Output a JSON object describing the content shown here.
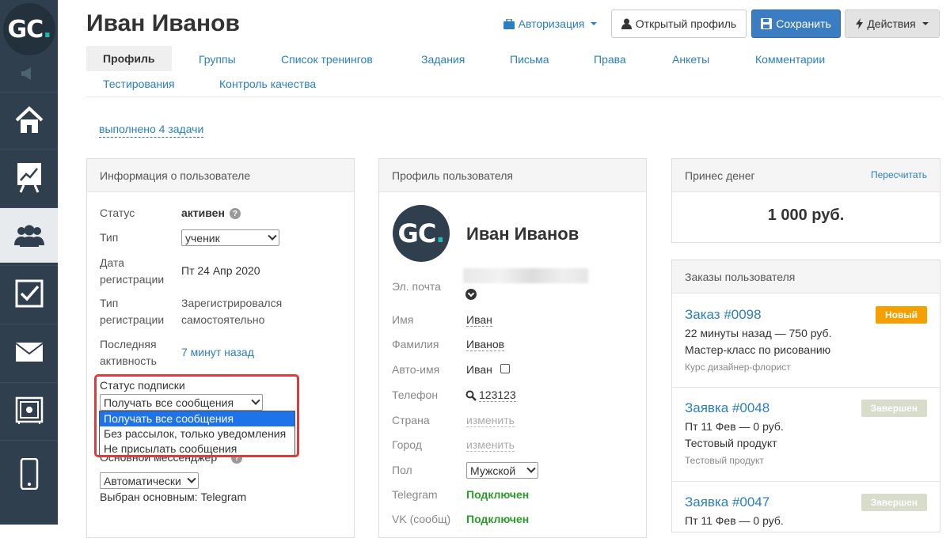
{
  "logo": {
    "text": "GC",
    "dot": "."
  },
  "sidebar": {
    "items": [
      {
        "icon": "home-icon"
      },
      {
        "icon": "chart-board-icon"
      },
      {
        "icon": "users-icon",
        "active": true
      },
      {
        "icon": "checkbox-icon"
      },
      {
        "icon": "mail-icon"
      },
      {
        "icon": "safe-icon"
      },
      {
        "icon": "mobile-icon"
      }
    ]
  },
  "header": {
    "title": "Иван Иванов",
    "auth_label": "Авторизация",
    "open_profile_label": "Открытый профиль",
    "save_label": "Сохранить",
    "actions_label": "Действия"
  },
  "tabs": [
    {
      "label": "Профиль",
      "active": true
    },
    {
      "label": "Группы"
    },
    {
      "label": "Список тренингов"
    },
    {
      "label": "Задания"
    },
    {
      "label": "Письма"
    },
    {
      "label": "Права"
    },
    {
      "label": "Анкеты"
    },
    {
      "label": "Комментарии"
    },
    {
      "label": "Тестирования"
    },
    {
      "label": "Контроль качества"
    }
  ],
  "tasks_link": "выполнено 4 задачи",
  "user_info": {
    "heading": "Информация о пользователе",
    "status_label": "Статус",
    "status_value": "активен",
    "help_glyph": "?",
    "type_label": "Тип",
    "type_value": "ученик",
    "reg_date_label_1": "Дата",
    "reg_date_label_2": "регистрации",
    "reg_date_value": "Пт 24 Апр 2020",
    "reg_type_label_1": "Тип",
    "reg_type_label_2": "регистрации",
    "reg_type_value_1": "Зарегистрировался",
    "reg_type_value_2": "самостоятельно",
    "last_active_label_1": "Последняя",
    "last_active_label_2": "активность",
    "last_active_value": "7 минут назад",
    "subscription_label": "Статус подписки",
    "subscription_value": "Получать все сообщения",
    "subscription_options": [
      "Получать все сообщения",
      "Без рассылок, только уведомления",
      "Не присылать сообщения"
    ],
    "messenger_label": "Основной мессенджер",
    "messenger_value": "Автоматически",
    "messenger_selected": "Выбран основным: Telegram"
  },
  "profile": {
    "heading": "Профиль пользователя",
    "name": "Иван Иванов",
    "email_label": "Эл. почта",
    "first_name_label": "Имя",
    "first_name_value": "Иван",
    "last_name_label": "Фамилия",
    "last_name_value": "Иванов",
    "auto_name_label": "Авто-имя",
    "auto_name_value": "Иван",
    "phone_label": "Телефон",
    "phone_value": "123123",
    "country_label": "Страна",
    "country_value": "изменить",
    "city_label": "Город",
    "city_value": "изменить",
    "gender_label": "Пол",
    "gender_value": "Мужской",
    "telegram_label": "Telegram",
    "telegram_value": "Подключен",
    "vk_label": "VK (сообщ)",
    "vk_value": "Подключен"
  },
  "money": {
    "heading": "Принес денег",
    "recalc_label": "Пересчитать",
    "amount": "1 000 руб."
  },
  "orders": {
    "heading": "Заказы пользователя",
    "items": [
      {
        "title": "Заказ #0098",
        "meta": "22 минуты назад — 750 руб.",
        "product": "Мастер-класс по рисованию",
        "subtitle": "Курс дизайнер-флорист",
        "badge": "Новый"
      },
      {
        "title": "Заявка #0048",
        "meta": "Пт 11 Фев — 0 руб.",
        "product": "Тестовый продукт",
        "subtitle": "Тестовый продукт",
        "badge": "Завершен"
      },
      {
        "title": "Заявка #0047",
        "meta": "Пт 11 Фев — 0 руб.",
        "badge": "Завершен"
      }
    ]
  },
  "colors": {
    "sidebar_bg": "#2f3f4d",
    "link": "#2a7fc1",
    "save_button": "#3a7dc3",
    "badge_new": "#f5a000",
    "badge_done": "#d8dccb",
    "connected": "#2a9c2a",
    "dropdown_selected": "#1e73e8",
    "highlight": "#e03a3a"
  }
}
